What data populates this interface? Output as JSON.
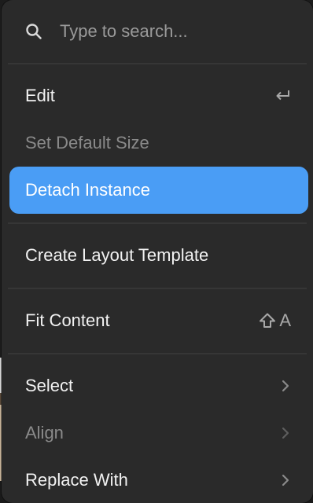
{
  "search": {
    "placeholder": "Type to search..."
  },
  "menu": {
    "edit": {
      "label": "Edit",
      "shortcut_icon": "return-icon"
    },
    "set_default_size": {
      "label": "Set Default Size"
    },
    "detach_instance": {
      "label": "Detach Instance"
    },
    "create_layout_template": {
      "label": "Create Layout Template"
    },
    "fit_content": {
      "label": "Fit Content",
      "shortcut_key": "A",
      "shortcut_icon": "shift-icon"
    },
    "select": {
      "label": "Select"
    },
    "align": {
      "label": "Align"
    },
    "replace_with": {
      "label": "Replace With"
    }
  },
  "colors": {
    "menu_background": "#2a2a2a",
    "accent": "#4a9df5",
    "text": "#f2f2f2",
    "disabled_text": "#8a8a8a"
  }
}
